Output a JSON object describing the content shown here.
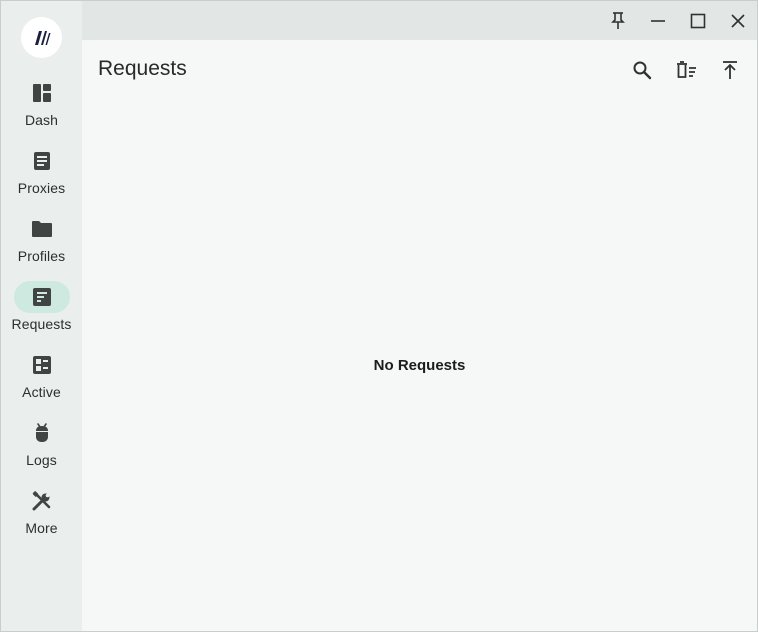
{
  "window": {
    "title_buttons": [
      "pin-icon",
      "minimize-icon",
      "maximize-icon",
      "close-icon"
    ]
  },
  "sidebar": {
    "logo_icon": "app-logo",
    "active": "Requests",
    "items": [
      {
        "label": "Dash",
        "icon": "dashboard-icon"
      },
      {
        "label": "Proxies",
        "icon": "document-icon"
      },
      {
        "label": "Profiles",
        "icon": "folder-icon"
      },
      {
        "label": "Requests",
        "icon": "requests-icon"
      },
      {
        "label": "Active",
        "icon": "connections-icon"
      },
      {
        "label": "Logs",
        "icon": "bug-icon"
      },
      {
        "label": "More",
        "icon": "tools-icon"
      }
    ]
  },
  "main": {
    "title": "Requests",
    "actions": [
      "search-icon",
      "clear-icon",
      "scroll-top-icon"
    ],
    "empty_message": "No Requests"
  },
  "colors": {
    "active_pill": "#cde9e0",
    "content_bg": "#f5f8f7",
    "sidebar_bg": "#eaeeec",
    "titlebar_bg": "#e2e6e4",
    "icon": "#404443"
  }
}
